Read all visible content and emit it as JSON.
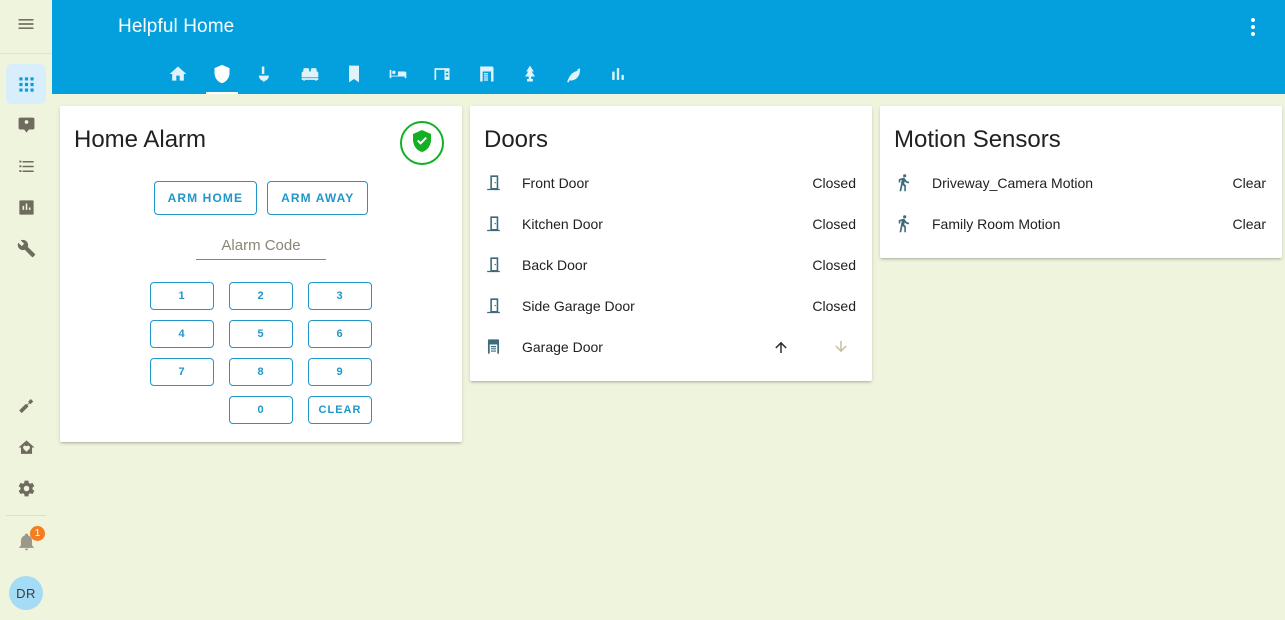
{
  "sidebar": {
    "menu_icon": "hamburger-menu-icon",
    "items": [
      {
        "icon": "view-dashboard-icon",
        "name": "sidebar-item-overview",
        "active": true
      },
      {
        "icon": "map-marker-account-icon",
        "name": "sidebar-item-map",
        "active": false
      },
      {
        "icon": "format-list-bulleted-icon",
        "name": "sidebar-item-logbook",
        "active": false
      },
      {
        "icon": "chart-box-icon",
        "name": "sidebar-item-history",
        "active": false
      },
      {
        "icon": "wrench-icon",
        "name": "sidebar-item-developer-tools",
        "active": false
      }
    ],
    "lower_items": [
      {
        "icon": "hammer-icon",
        "name": "sidebar-item-hammer"
      },
      {
        "icon": "home-heart-icon",
        "name": "sidebar-item-home"
      },
      {
        "icon": "cog-icon",
        "name": "sidebar-item-settings"
      }
    ],
    "notifications": {
      "icon": "bell-icon",
      "count": "1"
    },
    "user": {
      "initials": "DR"
    }
  },
  "header": {
    "title": "Helpful Home",
    "menu_icon": "dots-vertical-icon",
    "accent": "#03a0dd"
  },
  "tabs": [
    {
      "icon": "home-icon",
      "name": "tab-home",
      "active": false
    },
    {
      "icon": "shield-icon",
      "name": "tab-security",
      "active": true
    },
    {
      "icon": "mortar-pestle-icon",
      "name": "tab-kitchen",
      "active": false
    },
    {
      "icon": "sofa-icon",
      "name": "tab-living-room",
      "active": false
    },
    {
      "icon": "locker-icon",
      "name": "tab-laundry",
      "active": false
    },
    {
      "icon": "bed-icon",
      "name": "tab-bedroom",
      "active": false
    },
    {
      "icon": "desk-icon",
      "name": "tab-office",
      "active": false
    },
    {
      "icon": "garage-icon",
      "name": "tab-garage",
      "active": false
    },
    {
      "icon": "pine-tree-icon",
      "name": "tab-outdoors",
      "active": false
    },
    {
      "icon": "leaf-icon",
      "name": "tab-energy",
      "active": false
    },
    {
      "icon": "chart-bar-icon",
      "name": "tab-statistics",
      "active": false
    }
  ],
  "alarm_card": {
    "title": "Home Alarm",
    "status_icon": "shield-check-icon",
    "status_color": "#12b022",
    "buttons": [
      {
        "label": "ARM HOME",
        "name": "arm-home-button"
      },
      {
        "label": "ARM AWAY",
        "name": "arm-away-button"
      }
    ],
    "code_input": {
      "placeholder": "Alarm Code",
      "value": ""
    },
    "keypad": [
      {
        "label": "1",
        "name": "keypad-1"
      },
      {
        "label": "2",
        "name": "keypad-2"
      },
      {
        "label": "3",
        "name": "keypad-3"
      },
      {
        "label": "4",
        "name": "keypad-4"
      },
      {
        "label": "5",
        "name": "keypad-5"
      },
      {
        "label": "6",
        "name": "keypad-6"
      },
      {
        "label": "7",
        "name": "keypad-7"
      },
      {
        "label": "8",
        "name": "keypad-8"
      },
      {
        "label": "9",
        "name": "keypad-9"
      },
      {
        "label": "",
        "name": "keypad-blank"
      },
      {
        "label": "0",
        "name": "keypad-0"
      },
      {
        "label": "CLEAR",
        "name": "keypad-clear"
      }
    ]
  },
  "doors_card": {
    "title": "Doors",
    "rows": [
      {
        "icon": "door-closed-icon",
        "name": "Front Door",
        "state": "Closed"
      },
      {
        "icon": "door-closed-icon",
        "name": "Kitchen Door",
        "state": "Closed"
      },
      {
        "icon": "door-closed-icon",
        "name": "Back Door",
        "state": "Closed"
      },
      {
        "icon": "door-closed-icon",
        "name": "Side Garage Door",
        "state": "Closed"
      },
      {
        "icon": "garage-icon",
        "name": "Garage Door",
        "state": "",
        "actions": [
          "arrow-up-icon",
          "arrow-down-icon"
        ]
      }
    ]
  },
  "motion_card": {
    "title": "Motion Sensors",
    "rows": [
      {
        "icon": "walk-icon",
        "name": "Driveway_Camera Motion",
        "state": "Clear"
      },
      {
        "icon": "walk-icon",
        "name": "Family Room Motion",
        "state": "Clear"
      }
    ]
  }
}
